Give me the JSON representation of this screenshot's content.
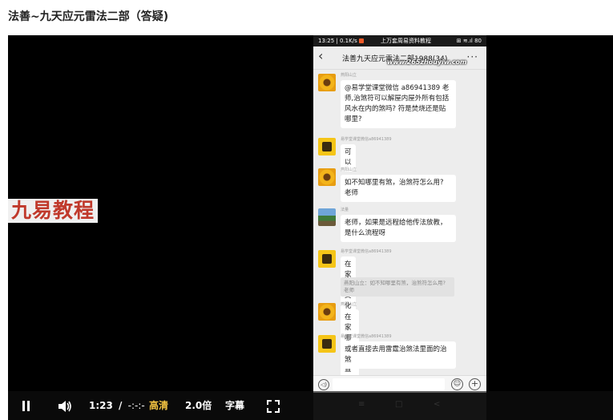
{
  "page": {
    "title": "法善~九天应元雷法二部（答疑)"
  },
  "watermark": "九易教程",
  "phone": {
    "status": {
      "time": "13:25 | 0.1K/s",
      "notice": "上万套周易资料教程",
      "system": "⊞ ≋.ıl 80"
    },
    "chat": {
      "back": "‹",
      "title": "法善九天应元雷法二部1988(34)",
      "more": "···",
      "url": "www.265zhouyiw.com"
    },
    "messages": [
      {
        "sender": "燕阳山立",
        "text": [
          "@易学堂课堂微信 a86941389 老",
          "师,治煞符可以解屋内屋外所有包括",
          "风水在内的煞吗? 符是焚烧还是贴",
          "哪里?"
        ]
      },
      {
        "sender": "易学堂课堂微信a86941389",
        "text": [
          "可以"
        ]
      },
      {
        "sender": "燕阳山立",
        "text": [
          "如不知哪里有煞，治煞符怎么用?",
          "老师"
        ]
      },
      {
        "sender": "法量",
        "text": [
          "老师，如果是远程给他传法放教，",
          "是什么流程呀"
        ]
      },
      {
        "sender": "易学堂课堂微信a86941389",
        "text": [
          "在家中焚化即可"
        ]
      },
      {
        "quote": "燕阳山立：如不知哪里有煞，治煞符怎么用? 老师"
      },
      {
        "sender": "燕阳山立",
        "text": [
          "在家哪个位置烧?"
        ]
      },
      {
        "sender": "易学堂课堂微信a86941389",
        "text": [
          "或者直接去用雷霆治煞法里面的治",
          "煞"
        ]
      }
    ],
    "input": {
      "voice": "◁)",
      "emoji": "☺",
      "plus": "+"
    },
    "nav": [
      "≡",
      "□",
      "<"
    ]
  },
  "controls": {
    "time": "1:23",
    "separator": "/",
    "duration": "-:-:-",
    "quality": "高清",
    "speed": "2.0倍",
    "subtitle": "字幕"
  }
}
